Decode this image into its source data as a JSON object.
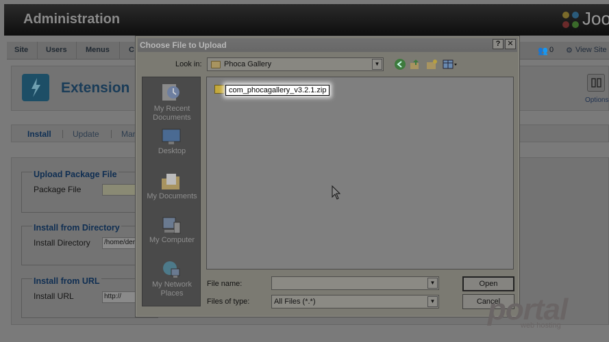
{
  "admin": {
    "title": "Administration",
    "logo_text": "Joo",
    "menu": [
      "Site",
      "Users",
      "Menus",
      "C"
    ],
    "menu_right": {
      "visitors_partial": "in",
      "admins_count": "0",
      "view_site": "View Site"
    },
    "extension_title": "Extension",
    "options_label": "Options",
    "tabs": [
      "Install",
      "Update",
      "Mar"
    ],
    "upload_section": {
      "legend": "Upload Package File",
      "label": "Package File"
    },
    "directory_section": {
      "legend": "Install from Directory",
      "label": "Install Directory",
      "value": "/home/der"
    },
    "url_section": {
      "legend": "Install from URL",
      "label": "Install URL",
      "value": "http://"
    }
  },
  "dialog": {
    "title": "Choose File to Upload",
    "help_button": "?",
    "close_button": "✕",
    "look_in_label": "Look in:",
    "look_in_value": "Phoca Gallery",
    "places": [
      {
        "label": "My Recent Documents",
        "icon": "recent-documents-icon"
      },
      {
        "label": "Desktop",
        "icon": "desktop-icon"
      },
      {
        "label": "My Documents",
        "icon": "my-documents-icon"
      },
      {
        "label": "My Computer",
        "icon": "my-computer-icon"
      },
      {
        "label": "My Network Places",
        "icon": "network-places-icon"
      }
    ],
    "files": [
      {
        "name": "com_phocagallery_v3.2.1.zip",
        "icon": "zip-folder-icon"
      }
    ],
    "file_name_label": "File name:",
    "file_name_value": "",
    "files_of_type_label": "Files of type:",
    "files_of_type_value": "All Files (*.*)",
    "open_button": "Open",
    "cancel_button": "Cancel"
  },
  "watermark": {
    "text": "portal",
    "sub": "web hosting"
  }
}
